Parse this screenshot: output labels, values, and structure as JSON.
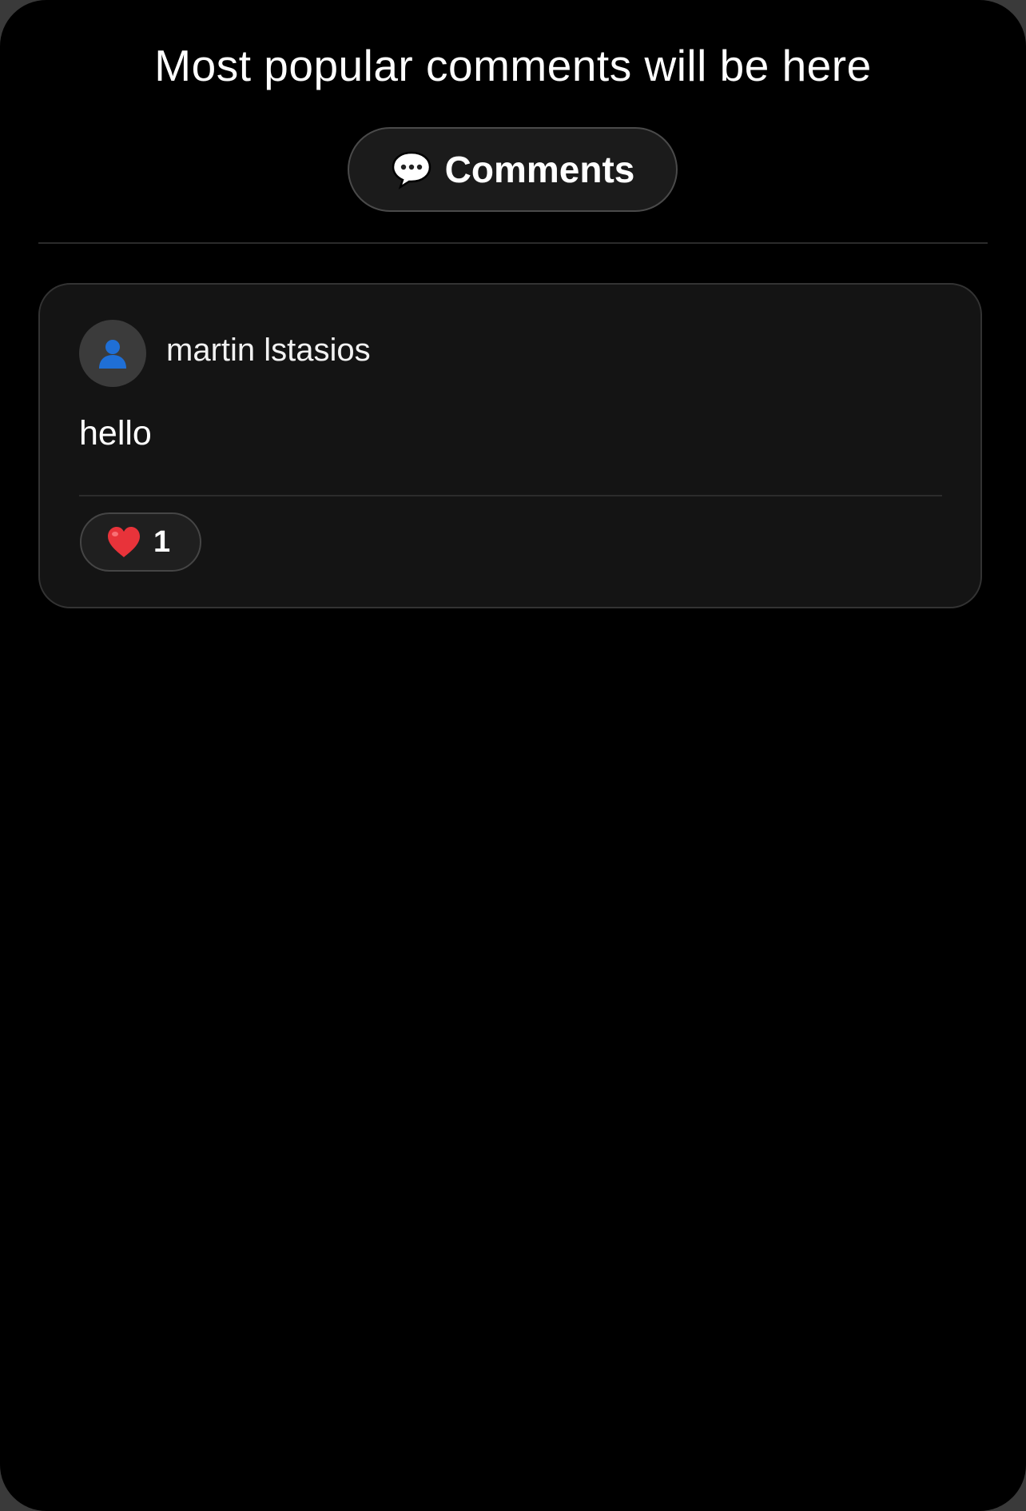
{
  "header": {
    "title": "Most popular comments will be here"
  },
  "comments_button": {
    "icon": "speech-bubble-icon",
    "label": "Comments"
  },
  "comments": [
    {
      "author": "martin lstasios",
      "avatar_icon": "user-silhouette-icon",
      "text": "hello",
      "reaction_icon": "heart-icon",
      "likes": "1"
    }
  ],
  "colors": {
    "background": "#000000",
    "card": "#141414",
    "button": "#1b1b1b",
    "heart": "#e8333a",
    "avatar_icon": "#1f6fd6"
  }
}
